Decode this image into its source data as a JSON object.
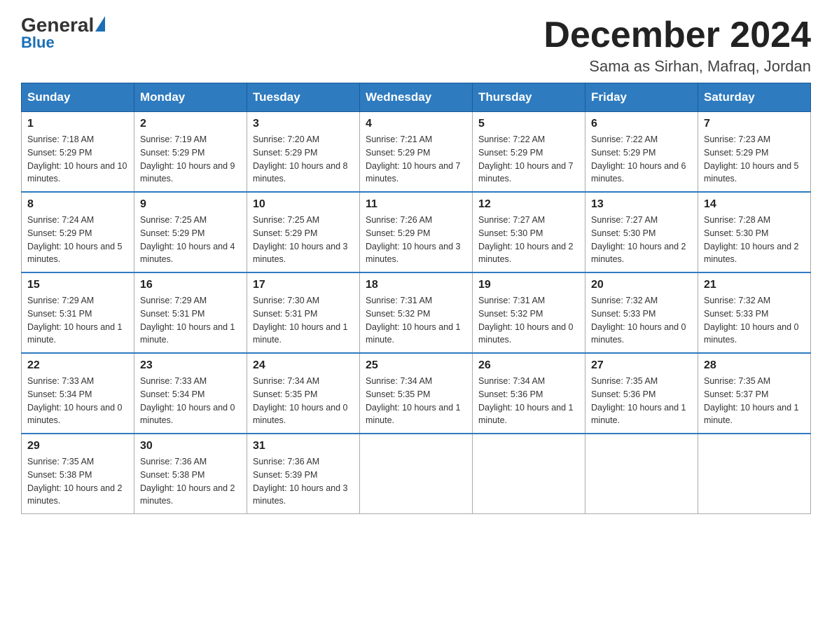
{
  "header": {
    "logo_general": "General",
    "logo_blue": "Blue",
    "main_title": "December 2024",
    "subtitle": "Sama as Sirhan, Mafraq, Jordan"
  },
  "days_of_week": [
    "Sunday",
    "Monday",
    "Tuesday",
    "Wednesday",
    "Thursday",
    "Friday",
    "Saturday"
  ],
  "weeks": [
    [
      {
        "day": "1",
        "sunrise": "7:18 AM",
        "sunset": "5:29 PM",
        "daylight": "10 hours and 10 minutes."
      },
      {
        "day": "2",
        "sunrise": "7:19 AM",
        "sunset": "5:29 PM",
        "daylight": "10 hours and 9 minutes."
      },
      {
        "day": "3",
        "sunrise": "7:20 AM",
        "sunset": "5:29 PM",
        "daylight": "10 hours and 8 minutes."
      },
      {
        "day": "4",
        "sunrise": "7:21 AM",
        "sunset": "5:29 PM",
        "daylight": "10 hours and 7 minutes."
      },
      {
        "day": "5",
        "sunrise": "7:22 AM",
        "sunset": "5:29 PM",
        "daylight": "10 hours and 7 minutes."
      },
      {
        "day": "6",
        "sunrise": "7:22 AM",
        "sunset": "5:29 PM",
        "daylight": "10 hours and 6 minutes."
      },
      {
        "day": "7",
        "sunrise": "7:23 AM",
        "sunset": "5:29 PM",
        "daylight": "10 hours and 5 minutes."
      }
    ],
    [
      {
        "day": "8",
        "sunrise": "7:24 AM",
        "sunset": "5:29 PM",
        "daylight": "10 hours and 5 minutes."
      },
      {
        "day": "9",
        "sunrise": "7:25 AM",
        "sunset": "5:29 PM",
        "daylight": "10 hours and 4 minutes."
      },
      {
        "day": "10",
        "sunrise": "7:25 AM",
        "sunset": "5:29 PM",
        "daylight": "10 hours and 3 minutes."
      },
      {
        "day": "11",
        "sunrise": "7:26 AM",
        "sunset": "5:29 PM",
        "daylight": "10 hours and 3 minutes."
      },
      {
        "day": "12",
        "sunrise": "7:27 AM",
        "sunset": "5:30 PM",
        "daylight": "10 hours and 2 minutes."
      },
      {
        "day": "13",
        "sunrise": "7:27 AM",
        "sunset": "5:30 PM",
        "daylight": "10 hours and 2 minutes."
      },
      {
        "day": "14",
        "sunrise": "7:28 AM",
        "sunset": "5:30 PM",
        "daylight": "10 hours and 2 minutes."
      }
    ],
    [
      {
        "day": "15",
        "sunrise": "7:29 AM",
        "sunset": "5:31 PM",
        "daylight": "10 hours and 1 minute."
      },
      {
        "day": "16",
        "sunrise": "7:29 AM",
        "sunset": "5:31 PM",
        "daylight": "10 hours and 1 minute."
      },
      {
        "day": "17",
        "sunrise": "7:30 AM",
        "sunset": "5:31 PM",
        "daylight": "10 hours and 1 minute."
      },
      {
        "day": "18",
        "sunrise": "7:31 AM",
        "sunset": "5:32 PM",
        "daylight": "10 hours and 1 minute."
      },
      {
        "day": "19",
        "sunrise": "7:31 AM",
        "sunset": "5:32 PM",
        "daylight": "10 hours and 0 minutes."
      },
      {
        "day": "20",
        "sunrise": "7:32 AM",
        "sunset": "5:33 PM",
        "daylight": "10 hours and 0 minutes."
      },
      {
        "day": "21",
        "sunrise": "7:32 AM",
        "sunset": "5:33 PM",
        "daylight": "10 hours and 0 minutes."
      }
    ],
    [
      {
        "day": "22",
        "sunrise": "7:33 AM",
        "sunset": "5:34 PM",
        "daylight": "10 hours and 0 minutes."
      },
      {
        "day": "23",
        "sunrise": "7:33 AM",
        "sunset": "5:34 PM",
        "daylight": "10 hours and 0 minutes."
      },
      {
        "day": "24",
        "sunrise": "7:34 AM",
        "sunset": "5:35 PM",
        "daylight": "10 hours and 0 minutes."
      },
      {
        "day": "25",
        "sunrise": "7:34 AM",
        "sunset": "5:35 PM",
        "daylight": "10 hours and 1 minute."
      },
      {
        "day": "26",
        "sunrise": "7:34 AM",
        "sunset": "5:36 PM",
        "daylight": "10 hours and 1 minute."
      },
      {
        "day": "27",
        "sunrise": "7:35 AM",
        "sunset": "5:36 PM",
        "daylight": "10 hours and 1 minute."
      },
      {
        "day": "28",
        "sunrise": "7:35 AM",
        "sunset": "5:37 PM",
        "daylight": "10 hours and 1 minute."
      }
    ],
    [
      {
        "day": "29",
        "sunrise": "7:35 AM",
        "sunset": "5:38 PM",
        "daylight": "10 hours and 2 minutes."
      },
      {
        "day": "30",
        "sunrise": "7:36 AM",
        "sunset": "5:38 PM",
        "daylight": "10 hours and 2 minutes."
      },
      {
        "day": "31",
        "sunrise": "7:36 AM",
        "sunset": "5:39 PM",
        "daylight": "10 hours and 3 minutes."
      },
      null,
      null,
      null,
      null
    ]
  ]
}
